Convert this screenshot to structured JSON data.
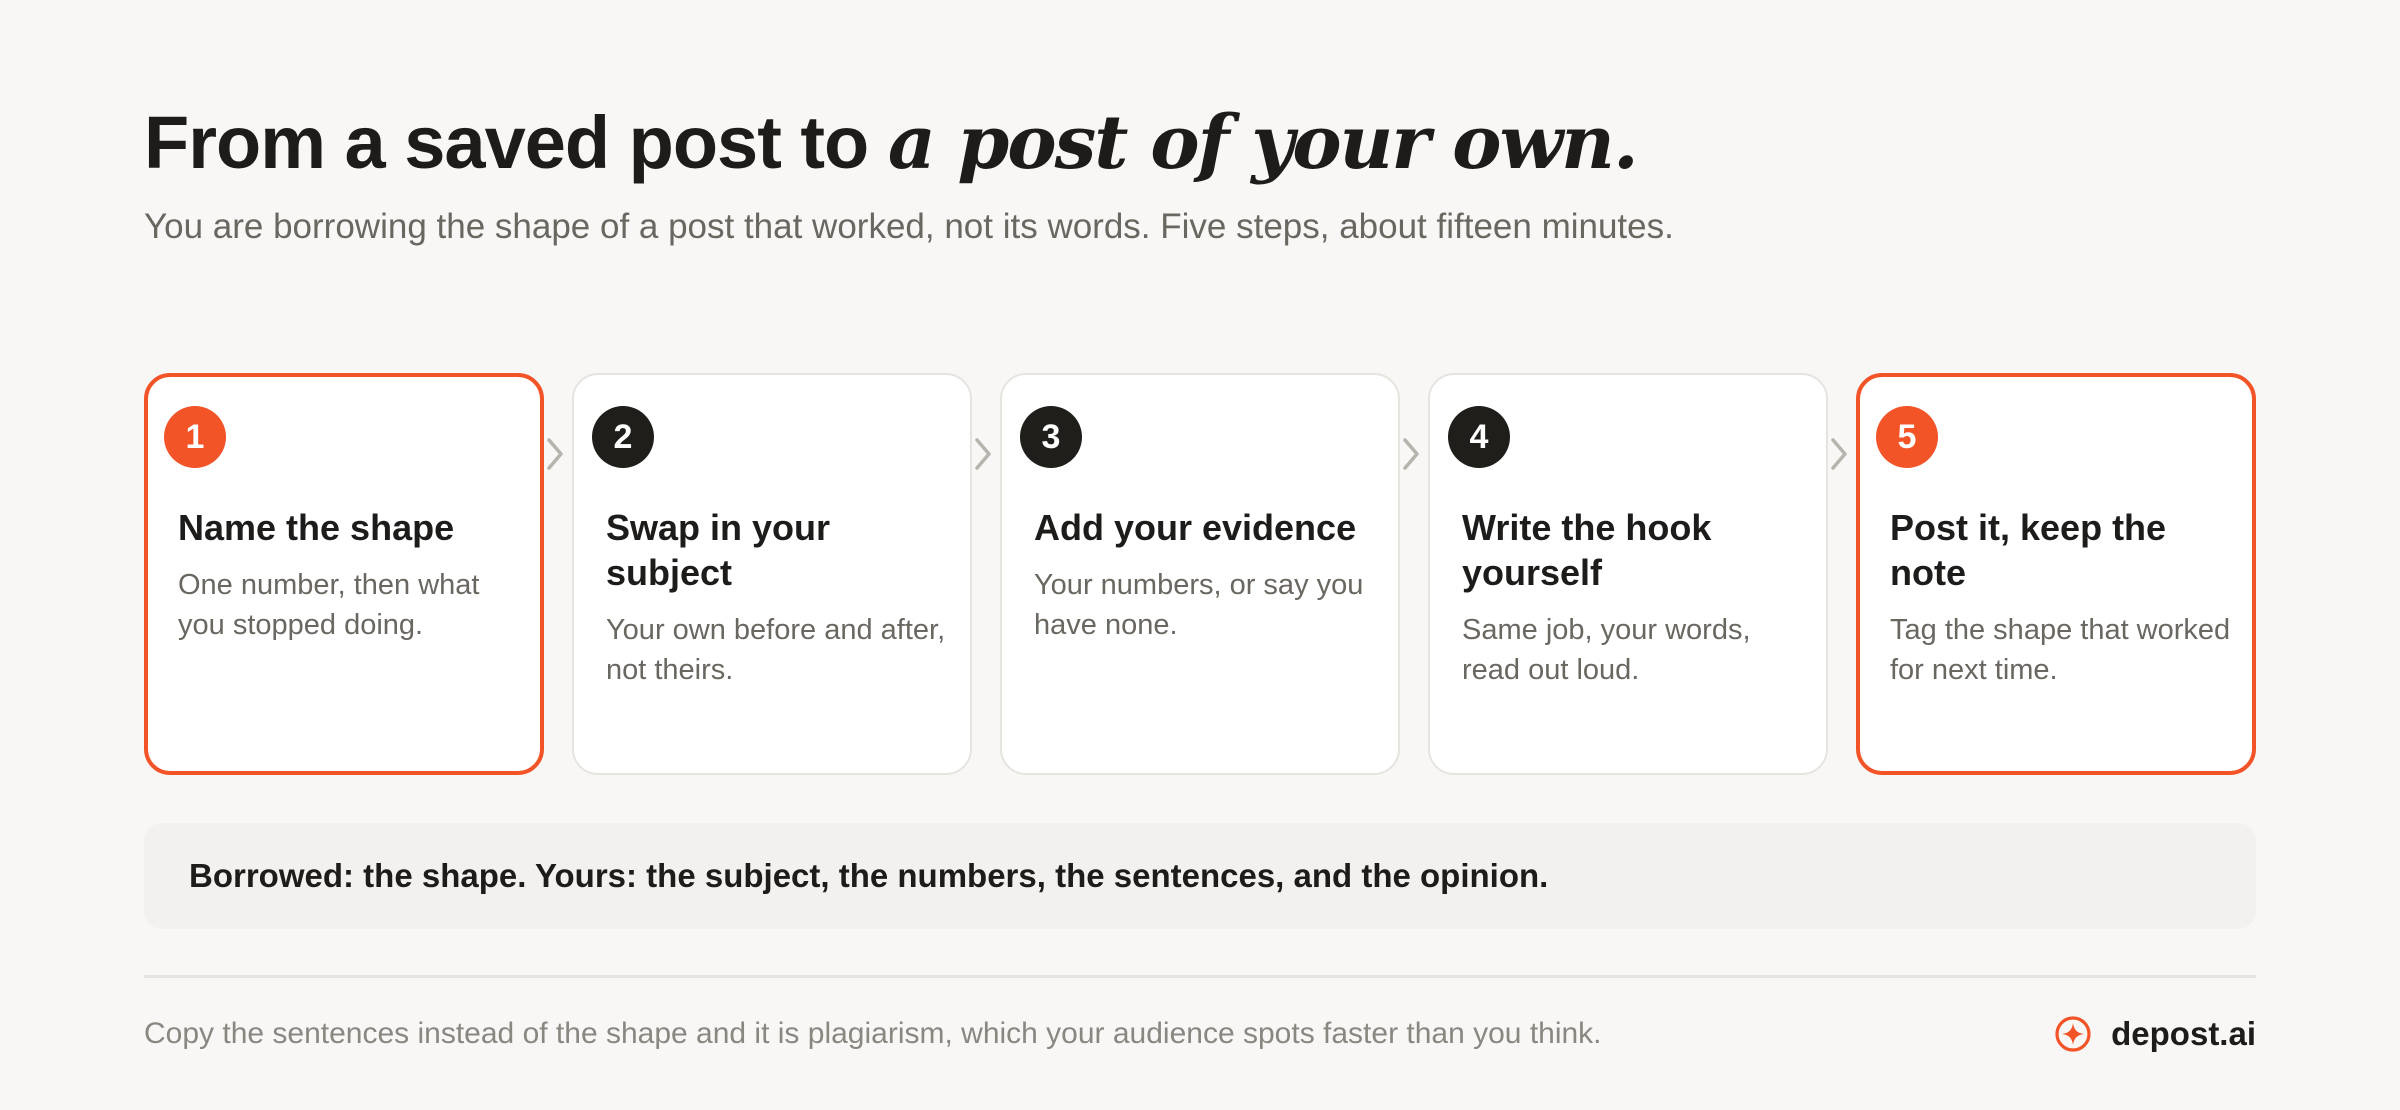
{
  "header": {
    "title_plain": "From a saved post to ",
    "title_italic": "a post of your own.",
    "subtitle": "You are borrowing the shape of a post that worked, not its words. Five steps, about fifteen minutes."
  },
  "steps": [
    {
      "number": "1",
      "title": "Name the shape",
      "description": "One number, then what you stopped doing.",
      "highlighted": true
    },
    {
      "number": "2",
      "title": "Swap in your subject",
      "description": "Your own before and after, not theirs.",
      "highlighted": false
    },
    {
      "number": "3",
      "title": "Add your evidence",
      "description": "Your numbers, or say you have none.",
      "highlighted": false
    },
    {
      "number": "4",
      "title": "Write the hook yourself",
      "description": "Same job, your words, read out loud.",
      "highlighted": false
    },
    {
      "number": "5",
      "title": "Post it, keep the note",
      "description": "Tag the shape that worked for next time.",
      "highlighted": true
    }
  ],
  "summary": "Borrowed: the shape. Yours: the subject, the numbers, the sentences, and the opinion.",
  "footer": {
    "warning": "Copy the sentences instead of the shape and it is plagiarism, which your audience spots faster than you think.",
    "brand": "depost.ai",
    "brand_icon": "sparkle-circle-icon"
  },
  "colors": {
    "accent": "#f25327",
    "dark": "#1f1e1b",
    "background": "#f8f7f5",
    "muted_text": "#6a6761"
  }
}
